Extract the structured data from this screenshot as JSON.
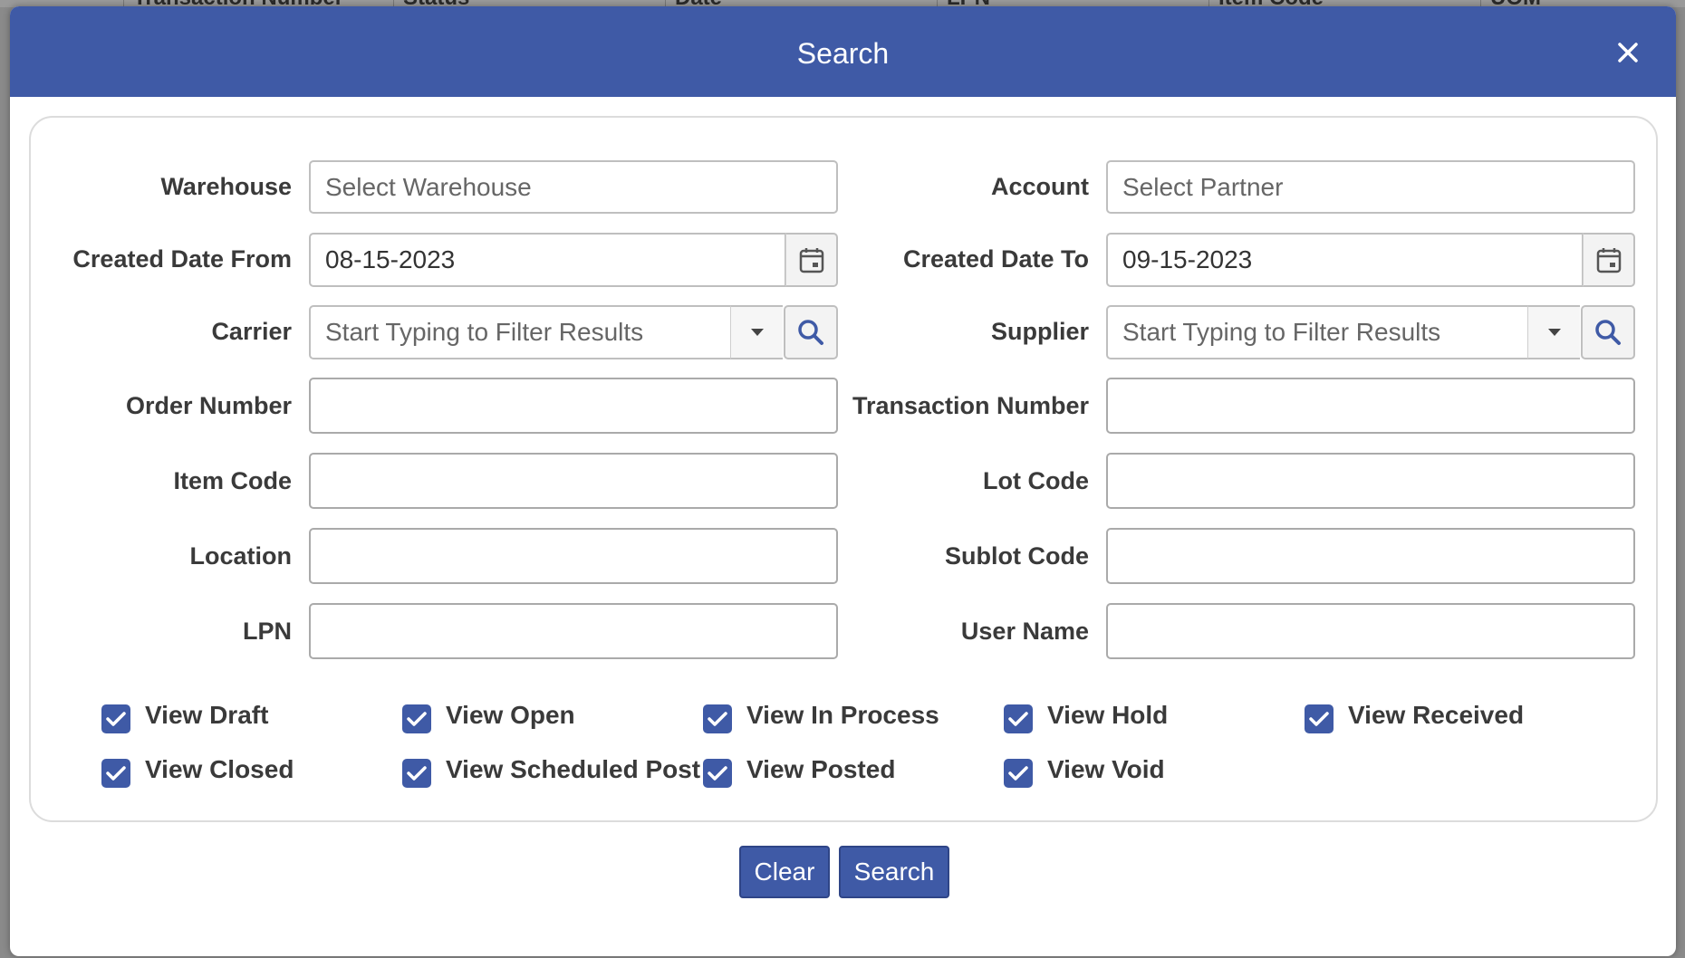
{
  "background_table": {
    "columns": [
      "Transaction Number",
      "Status",
      "Date",
      "LPN",
      "Item Code",
      "UOM"
    ]
  },
  "modal": {
    "title": "Search"
  },
  "form": {
    "warehouse": {
      "label": "Warehouse",
      "placeholder": "Select Warehouse"
    },
    "account": {
      "label": "Account",
      "placeholder": "Select Partner"
    },
    "created_from": {
      "label": "Created Date From",
      "value": "08-15-2023"
    },
    "created_to": {
      "label": "Created Date To",
      "value": "09-15-2023"
    },
    "carrier": {
      "label": "Carrier",
      "placeholder": "Start Typing to Filter Results"
    },
    "supplier": {
      "label": "Supplier",
      "placeholder": "Start Typing to Filter Results"
    },
    "order_number": {
      "label": "Order Number",
      "value": ""
    },
    "transaction_number": {
      "label": "Transaction Number",
      "value": ""
    },
    "item_code": {
      "label": "Item Code",
      "value": ""
    },
    "lot_code": {
      "label": "Lot Code",
      "value": ""
    },
    "location": {
      "label": "Location",
      "value": ""
    },
    "sublot_code": {
      "label": "Sublot Code",
      "value": ""
    },
    "lpn": {
      "label": "LPN",
      "value": ""
    },
    "user_name": {
      "label": "User Name",
      "value": ""
    }
  },
  "checkboxes": [
    {
      "label": "View Draft",
      "checked": true
    },
    {
      "label": "View Open",
      "checked": true
    },
    {
      "label": "View In Process",
      "checked": true
    },
    {
      "label": "View Hold",
      "checked": true
    },
    {
      "label": "View Received",
      "checked": true
    },
    {
      "label": "View Closed",
      "checked": true
    },
    {
      "label": "View Scheduled Post",
      "checked": true
    },
    {
      "label": "View Posted",
      "checked": true
    },
    {
      "label": "View Void",
      "checked": true
    }
  ],
  "buttons": {
    "clear": "Clear",
    "search": "Search"
  },
  "icons": {
    "close": "close-icon",
    "calendar": "calendar-icon",
    "dropdown": "caret-down-icon",
    "search": "search-icon",
    "check": "checkmark-icon"
  },
  "colors": {
    "primary": "#3f5aa6",
    "overlay": "#8a8a8a"
  }
}
